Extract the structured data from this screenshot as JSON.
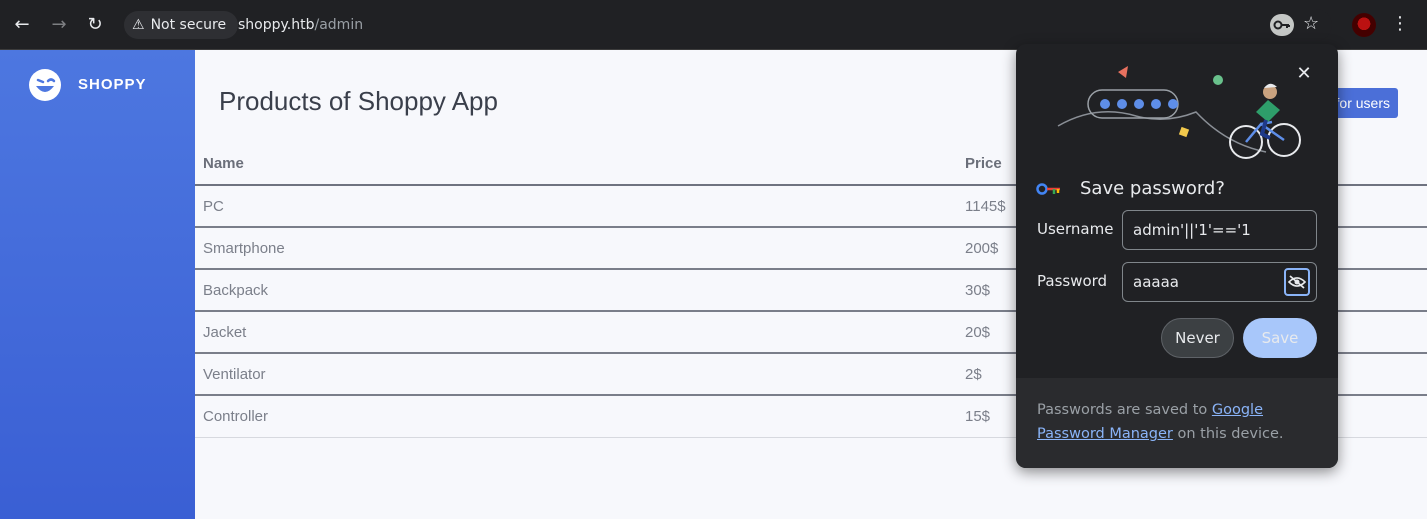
{
  "browser": {
    "security_label": "Not secure",
    "url_host": "shoppy.htb",
    "url_path": "/admin",
    "icons": [
      "back-icon",
      "forward-icon",
      "reload-icon",
      "warning-icon",
      "key-icon",
      "star-icon",
      "profile-avatar",
      "kebab-menu-icon"
    ]
  },
  "sidebar": {
    "brand": "SHOPPY"
  },
  "main": {
    "title": "Products of Shoppy App",
    "users_button": "for users",
    "table": {
      "headers": [
        "Name",
        "Price"
      ],
      "rows": [
        [
          "PC",
          "1145$"
        ],
        [
          "Smartphone",
          "200$"
        ],
        [
          "Backpack",
          "30$"
        ],
        [
          "Jacket",
          "20$"
        ],
        [
          "Ventilator",
          "2$"
        ],
        [
          "Controller",
          "15$"
        ]
      ]
    }
  },
  "popup": {
    "title": "Save password?",
    "username_label": "Username",
    "username_value": "admin'||'1'=='1",
    "password_label": "Password",
    "password_value": "aaaaa",
    "never_button": "Never",
    "save_button": "Save",
    "footer_prefix": "Passwords are saved to ",
    "footer_link": "Google Password Manager",
    "footer_suffix": " on this device."
  },
  "colors": {
    "sidebar": "#4d77e0",
    "accent": "#4b6fd8",
    "popup_bg": "#202124",
    "link": "#8ab4f8"
  }
}
